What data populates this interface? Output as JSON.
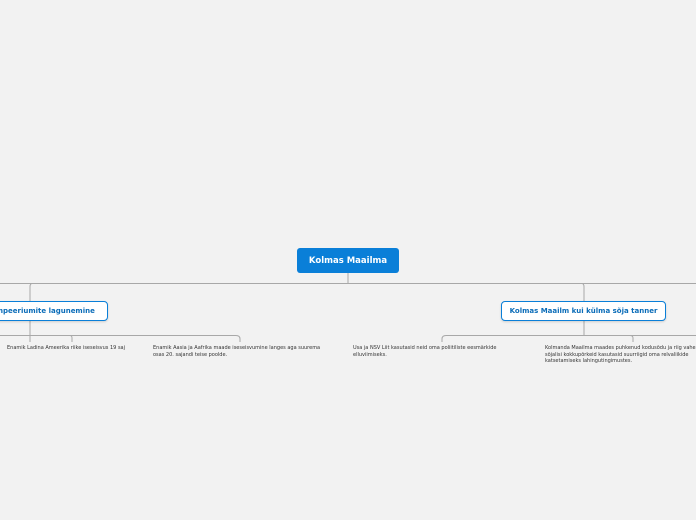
{
  "root": {
    "label": "Kolmas Maailma",
    "color": "#0a7fd8"
  },
  "topics": {
    "left": {
      "label": "Impeeriumite lagunemine",
      "subtopics": [
        "Enamik Ladina Ameerika riike iseseisvus 19 saj",
        "Enamik Aasia ja Aafrika maade iseseisvumine langes aga suurema osas 20. sajandi teise poolde."
      ]
    },
    "right": {
      "label": "Kolmas Maailm kui külma sõja tanner",
      "subtopics": [
        "Usa ja NSV Liit kasutasid neid oma poliitiliste eesmärkide elluviimiseks.",
        "Kolmanda Maailma maades puhkenud kodusõdu ja riig vahelisi sõjalisi kokkupõrkeid kasutasid suurriigid oma relvaliikide katsetamiseks lahingutingimustes."
      ]
    }
  },
  "colors": {
    "connector": "#a8a8a8",
    "background": "#f2f2f2",
    "topic_border": "#0a7fd8"
  }
}
